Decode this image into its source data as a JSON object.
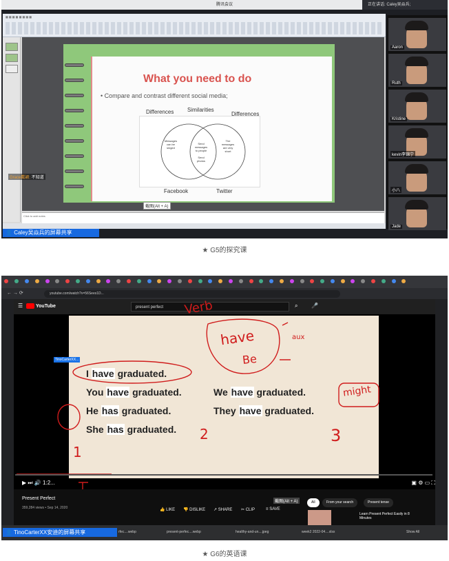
{
  "shot1": {
    "window_title": "腾讯会议",
    "speaking": "正在讲话: Caley吴焱兵;",
    "slide": {
      "title": "What you need to do",
      "bullet": "Compare and contrast different social media;",
      "venn_labels": {
        "left": "Differences",
        "middle": "Similarities",
        "right": "Differences"
      },
      "venn_left_text": "Messages can be singed",
      "venn_center_text_1": "Send messages to people",
      "venn_center_text_2": "Send photos",
      "venn_right_text": "The messages are very short",
      "caption_left": "Facebook",
      "caption_right": "Twitter",
      "notes_placeholder": "Click to add notes"
    },
    "screenshot_tip": "截图(Alt + A)",
    "chat_caption": {
      "user": "Grace戴颖:",
      "text": "不知道"
    },
    "participants": [
      {
        "name": "Aaron"
      },
      {
        "name": "Ruth"
      },
      {
        "name": "Kristine"
      },
      {
        "name": "kevin李锦宁"
      },
      {
        "name": "小八"
      },
      {
        "name": "Jade"
      }
    ],
    "share_banner": "Caley吴焱兵的屏幕共享"
  },
  "caption1": "★ G5的探究课",
  "shot2": {
    "url": "youtube.com/watch?v=56Sees1D...",
    "search_query": "present perfect",
    "overlay_name": "TinoCarterXX...",
    "sentences": [
      {
        "pre": "I ",
        "verb": "have",
        "post": " graduated."
      },
      {
        "pre": "You ",
        "verb": "have",
        "post": " graduated."
      },
      {
        "pre": "He ",
        "verb": "has",
        "post": " graduated."
      },
      {
        "pre": "She ",
        "verb": "has",
        "post": " graduated."
      },
      {
        "pre": "We ",
        "verb": "have",
        "post": " graduated."
      },
      {
        "pre": "They ",
        "verb": "have",
        "post": " graduated."
      }
    ],
    "annotations": {
      "verb": "Verb",
      "have": "have",
      "be": "Be",
      "aux": "aux",
      "might": "might",
      "n2": "2",
      "n3": "3",
      "n1": "1"
    },
    "time": "1:2...",
    "video_title": "Present Perfect",
    "video_meta": "359,284 views • Sep 14, 2020",
    "actions": [
      "LIKE",
      "DISLIKE",
      "SHARE",
      "CLIP",
      "SAVE"
    ],
    "chips": [
      "All",
      "From your search",
      "Present tense"
    ],
    "screenshot_tip": "截图(Alt + A)",
    "rec_title": "Learn Present Perfect Easily in 8 Minutes",
    "downloads": [
      "rfec....webp",
      "present-perfec....webp",
      "healthy-and-un....jpeg",
      "week2 2022-04....xlsx"
    ],
    "show_all": "Show All",
    "share_banner": "TinoCarterXX安迪的屏幕共享"
  },
  "caption2": "★ G6的英语课"
}
